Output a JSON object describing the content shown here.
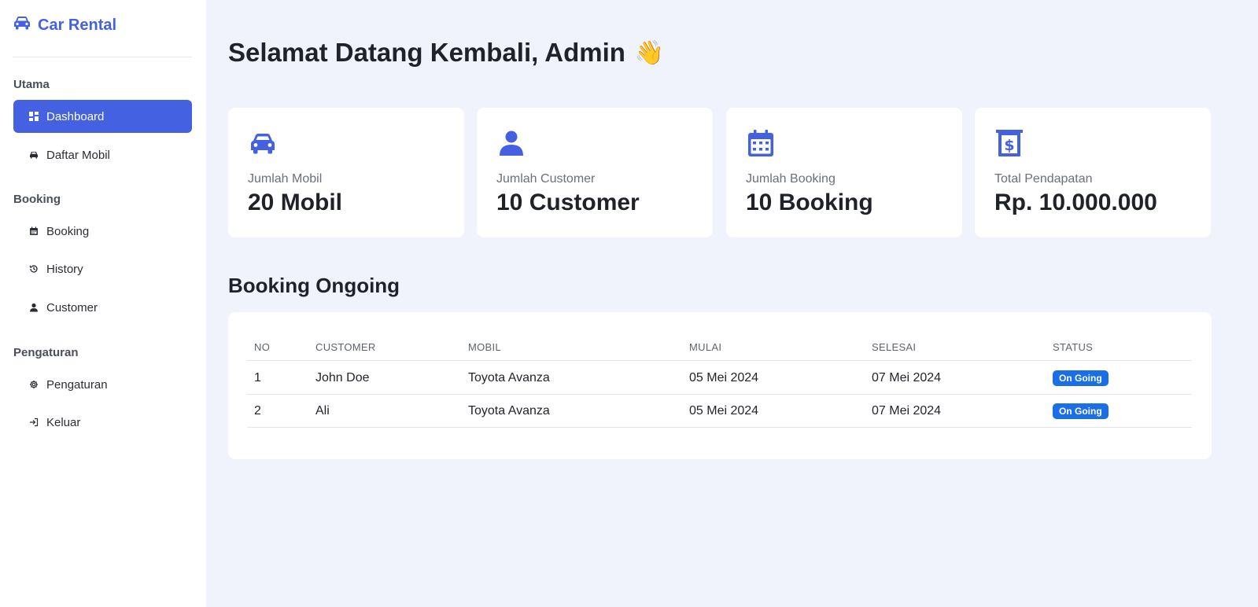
{
  "brand": {
    "name": "Car Rental",
    "icon": "car-icon",
    "color": "#4361e0"
  },
  "sidebar": {
    "sections": [
      {
        "title": "Utama",
        "items": [
          {
            "label": "Dashboard",
            "icon": "dashboard-icon",
            "active": true
          },
          {
            "label": "Daftar Mobil",
            "icon": "car-icon",
            "active": false
          }
        ]
      },
      {
        "title": "Booking",
        "items": [
          {
            "label": "Booking",
            "icon": "calendar-icon",
            "active": false
          },
          {
            "label": "History",
            "icon": "history-icon",
            "active": false
          },
          {
            "label": "Customer",
            "icon": "user-icon",
            "active": false
          }
        ]
      },
      {
        "title": "Pengaturan",
        "items": [
          {
            "label": "Pengaturan",
            "icon": "gear-icon",
            "active": false
          },
          {
            "label": "Keluar",
            "icon": "logout-icon",
            "active": false
          }
        ]
      }
    ]
  },
  "header": {
    "welcome": "Selamat Datang Kembali, Admin",
    "emoji": "👋"
  },
  "stats": [
    {
      "label": "Jumlah Mobil",
      "value": "20 Mobil",
      "icon": "car-icon"
    },
    {
      "label": "Jumlah Customer",
      "value": "10 Customer",
      "icon": "user-icon"
    },
    {
      "label": "Jumlah Booking",
      "value": "10 Booking",
      "icon": "calendar-icon"
    },
    {
      "label": "Total Pendapatan",
      "value": "Rp. 10.000.000",
      "icon": "receipt-dollar-icon"
    }
  ],
  "bookings": {
    "title": "Booking Ongoing",
    "columns": [
      "NO",
      "CUSTOMER",
      "MOBIL",
      "MULAI",
      "SELESAI",
      "STATUS"
    ],
    "rows": [
      {
        "no": "1",
        "customer": "John Doe",
        "mobil": "Toyota Avanza",
        "mulai": "05 Mei 2024",
        "selesai": "07 Mei 2024",
        "status": "On Going"
      },
      {
        "no": "2",
        "customer": "Ali",
        "mobil": "Toyota Avanza",
        "mulai": "05 Mei 2024",
        "selesai": "07 Mei 2024",
        "status": "On Going"
      }
    ]
  },
  "colors": {
    "accent": "#4361e0",
    "badge": "#1a6ee8",
    "background": "#f0f3fb"
  }
}
